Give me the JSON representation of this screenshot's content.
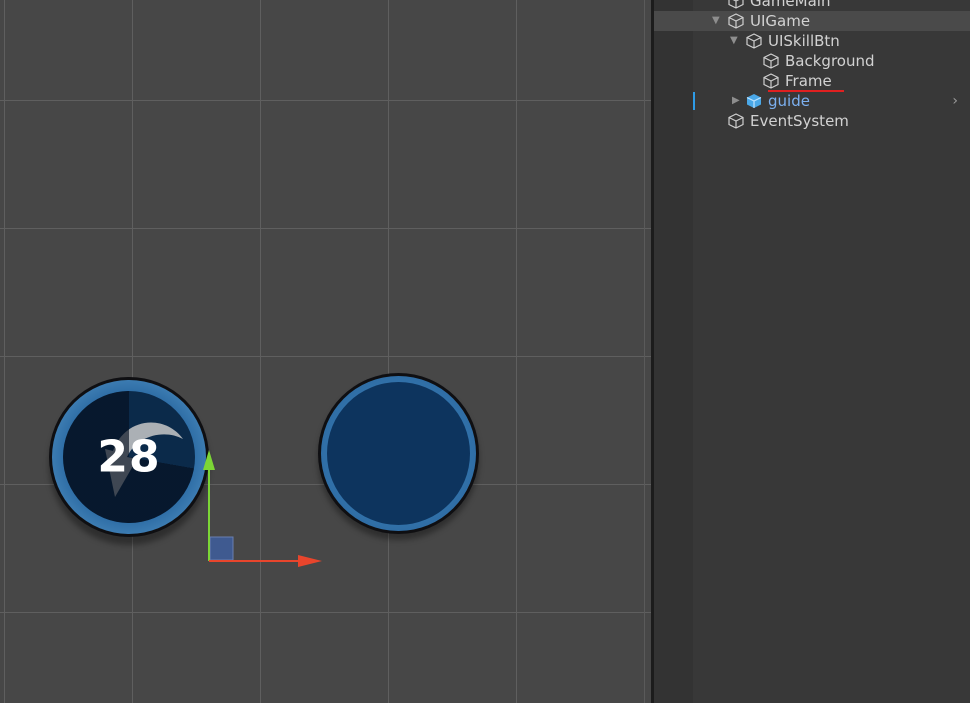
{
  "scene": {
    "cooldown_button": {
      "cooldown_value": "28",
      "icon": "rotate-arrow-icon"
    },
    "empty_button": {
      "icon": "none"
    },
    "gizmo": {
      "x_axis_color": "#e8452c",
      "y_axis_color": "#7cd636",
      "plane_color": "#3f5a90"
    }
  },
  "hierarchy": {
    "items": [
      {
        "label": "GameMain",
        "icon": "gameobject-cube-icon",
        "foldout": "none"
      },
      {
        "label": "UIGame",
        "icon": "gameobject-cube-icon",
        "foldout": "expanded",
        "selected": true
      },
      {
        "label": "UISkillBtn",
        "icon": "gameobject-cube-icon",
        "foldout": "expanded"
      },
      {
        "label": "Background",
        "icon": "gameobject-cube-icon",
        "foldout": "none"
      },
      {
        "label": "Frame",
        "icon": "gameobject-cube-icon",
        "foldout": "none",
        "annotated": true
      },
      {
        "label": "guide",
        "icon": "prefab-cube-icon",
        "foldout": "collapsed",
        "prefab": true
      },
      {
        "label": "EventSystem",
        "icon": "gameobject-cube-icon",
        "foldout": "none"
      }
    ],
    "annotation_color": "#e02020",
    "prefab_color": "#7cb0f0"
  }
}
